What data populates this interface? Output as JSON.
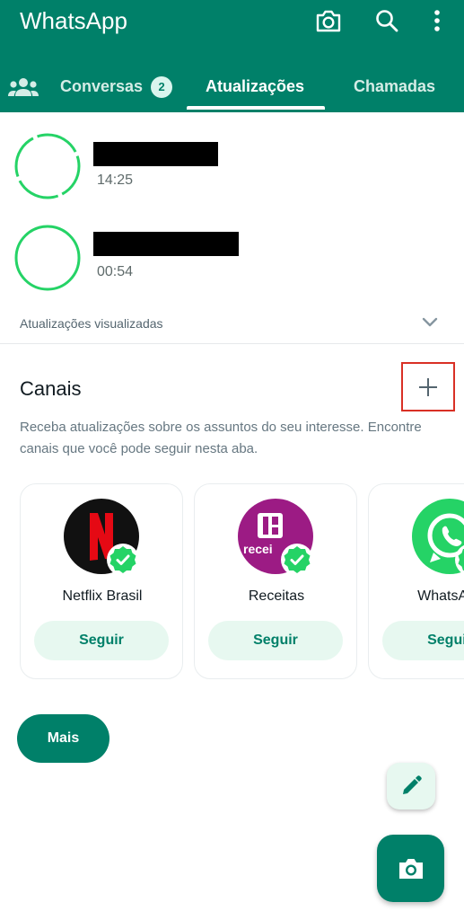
{
  "app": {
    "title": "WhatsApp"
  },
  "header_icons": [
    "camera-icon",
    "search-icon",
    "more-vert-icon"
  ],
  "tabs": {
    "communities_icon": "community-icon",
    "items": [
      {
        "label": "Conversas",
        "badge": "2"
      },
      {
        "label": "Atualizações",
        "active": true
      },
      {
        "label": "Chamadas"
      }
    ]
  },
  "statuses": [
    {
      "time": "14:25"
    },
    {
      "time": "00:54"
    }
  ],
  "viewed_updates_label": "Atualizações visualizadas",
  "channels": {
    "title": "Canais",
    "description": "Receba atualizações sobre os assuntos do seu interesse. Encontre canais que você pode seguir nesta aba.",
    "cards": [
      {
        "name": "Netflix Brasil",
        "follow_label": "Seguir",
        "avatar_text": "N"
      },
      {
        "name": "Receitas",
        "follow_label": "Seguir",
        "avatar_text": "recei"
      },
      {
        "name": "WhatsApp",
        "follow_label": "Seguir"
      }
    ],
    "more_label": "Mais"
  },
  "colors": {
    "brand": "#008069",
    "status_ring": "#25d366",
    "follow_bg": "#e7f8f0",
    "highlight_box": "#d93025"
  }
}
